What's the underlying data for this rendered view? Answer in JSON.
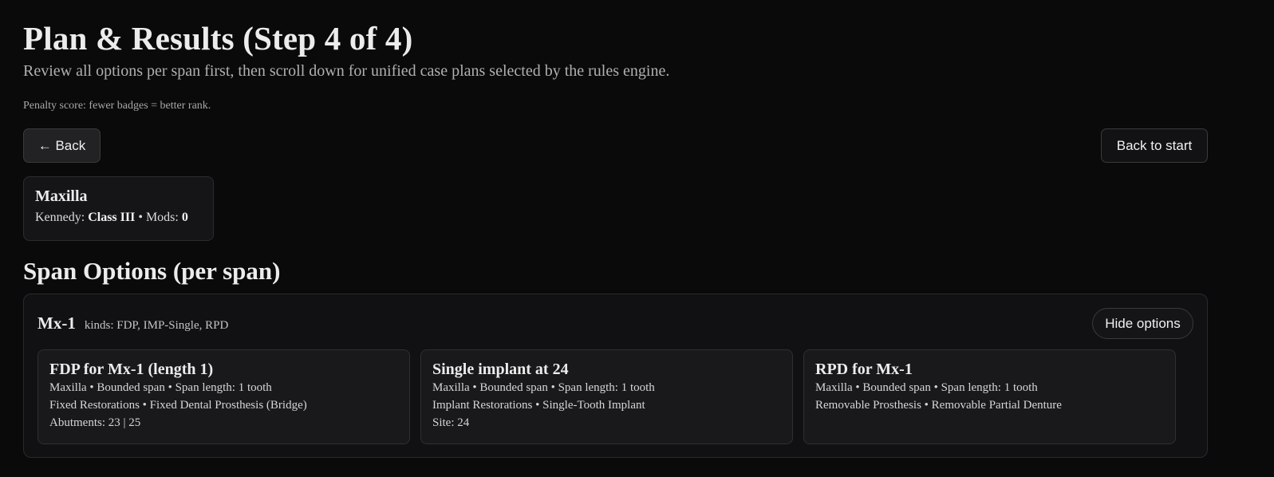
{
  "header": {
    "title": "Plan & Results (Step 4 of 4)",
    "subtitle": "Review all options per span first, then scroll down for unified case plans selected by the rules engine.",
    "penalty_note": "Penalty score: fewer badges = better rank."
  },
  "nav": {
    "back_label": "← Back",
    "back_to_start_label": "Back to start"
  },
  "arch": {
    "title": "Maxilla",
    "kennedy_label": "Kennedy: ",
    "kennedy_class": "Class III",
    "mods_label": " • Mods: ",
    "mods_value": "0"
  },
  "span_options": {
    "heading": "Span Options (per span)",
    "spans": [
      {
        "name": "Mx-1",
        "kinds": "kinds: FDP, IMP-Single, RPD",
        "toggle_label": "Hide options",
        "options": [
          {
            "title": "FDP for Mx-1 (length 1)",
            "meta": "Maxilla • Bounded span • Span length: 1 tooth",
            "category": "Fixed Restorations • Fixed Dental Prosthesis (Bridge)",
            "detail": "Abutments: 23 | 25"
          },
          {
            "title": "Single implant at 24",
            "meta": "Maxilla • Bounded span • Span length: 1 tooth",
            "category": "Implant Restorations • Single-Tooth Implant",
            "detail": "Site: 24"
          },
          {
            "title": "RPD for Mx-1",
            "meta": "Maxilla • Bounded span • Span length: 1 tooth",
            "category": "Removable Prosthesis • Removable Partial Denture",
            "detail": ""
          }
        ]
      }
    ]
  },
  "colors": {
    "background": "#0a0a0a",
    "card": "#151517",
    "border": "#2c2c2e",
    "text": "#ececec",
    "muted": "#b0b0b0"
  }
}
